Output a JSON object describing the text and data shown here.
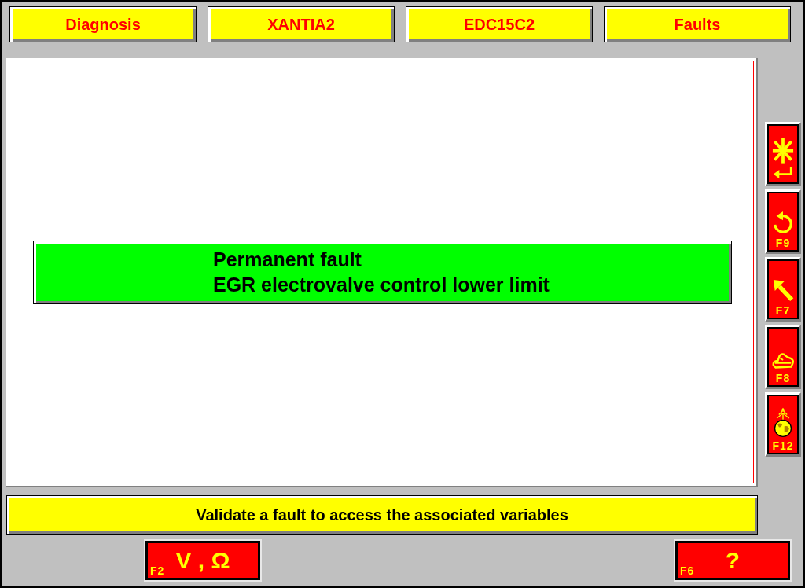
{
  "header": [
    {
      "label": "Diagnosis"
    },
    {
      "label": "XANTIA2"
    },
    {
      "label": "EDC15C2"
    },
    {
      "label": "Faults"
    }
  ],
  "faults": [
    {
      "status": "Permanent fault",
      "description": "EGR electrovalve control lower limit",
      "selected": true
    }
  ],
  "side_buttons": [
    {
      "kind": "validate"
    },
    {
      "kind": "undo",
      "key": "F9"
    },
    {
      "kind": "back",
      "key": "F7"
    },
    {
      "kind": "vehicle",
      "key": "F8"
    },
    {
      "kind": "globe",
      "key": "F12"
    }
  ],
  "status_bar": {
    "text": "Validate a fault to access the associated variables"
  },
  "bottom_buttons": [
    {
      "key": "F2",
      "label": "V , Ω"
    },
    {
      "key": "F6",
      "label": "?"
    }
  ]
}
